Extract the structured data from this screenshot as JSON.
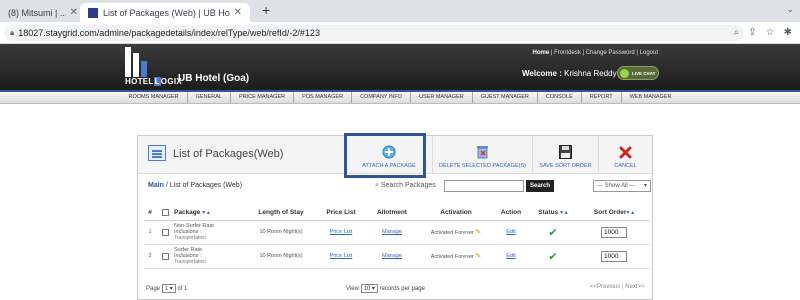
{
  "browser": {
    "tabs": [
      {
        "title": "(8) Mitsumi | ...",
        "active": false
      },
      {
        "title": "List of Packages (Web) | UB Hotel (Goa)",
        "active": true
      }
    ],
    "new_tab": "+",
    "address": "18027.staygrid.com/admine/packagedetails/index/relType/web/refId/-2/#123"
  },
  "header": {
    "logo_prefix": "HOTEL",
    "logo_suffix": "OGIX",
    "hotel_name": "UB Hotel (Goa)",
    "top_links": [
      "Home",
      "Frontdesk",
      "Change Password",
      "Logout"
    ],
    "welcome_label": "Welcome :",
    "user_name": "Krishna Reddy",
    "live_chat": "LIVE CHAT"
  },
  "menu": [
    "ROOMS MANAGER",
    "GENERAL",
    "PRICE MANAGER",
    "POS MANAGER",
    "COMPANY INFO",
    "USER MANAGER",
    "GUEST MANAGER",
    "CONSOLE",
    "REPORT",
    "WEB MANAGER"
  ],
  "panel": {
    "title": "List of Packages(Web)",
    "actions": {
      "attach": "ATTACH A PACKAGE",
      "delete": "DELETE SELECTED PACKAGE(S)",
      "save": "SAVE SORT ORDER",
      "cancel": "CANCEL"
    },
    "breadcrumb_main": "Main",
    "breadcrumb_rest": " / List of Packages (Web)",
    "search_label": "Search Packages",
    "search_button": "Search",
    "show_all": "--- Show All ---"
  },
  "table": {
    "headers": {
      "num": "#",
      "package": "Package",
      "length": "Length of Stay",
      "price": "Price List",
      "allotment": "Allotment",
      "activation": "Activation",
      "action": "Action",
      "status": "Status",
      "sort": "Sort Order"
    },
    "rows": [
      {
        "num": "1",
        "name": "Non-Surfer Rate",
        "incl": "Inclusions :",
        "incl_detail": "Transportation",
        "length": "10 Room Night(s)",
        "price": "Price List",
        "allotment": "Manage",
        "activation": "Activated Forever",
        "action": "Edit",
        "sort": "1000"
      },
      {
        "num": "2",
        "name": "Surfer Rate",
        "incl": "Inclusions :",
        "incl_detail": "Transportation",
        "length": "10 Room Night(s)",
        "price": "Price List",
        "allotment": "Manage",
        "activation": "Activated Forever",
        "action": "Edit",
        "sort": "1000"
      }
    ]
  },
  "pager": {
    "page_label": "Page",
    "page_value": "1",
    "of_label": "of 1",
    "view_label": "View",
    "view_value": "10",
    "records_label": "records per page",
    "prevnext": "<<Previous | Next>>"
  }
}
